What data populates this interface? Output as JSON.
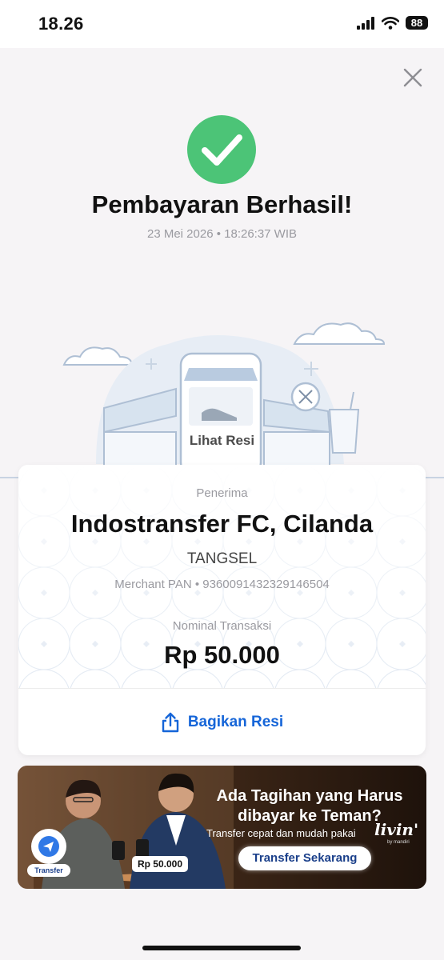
{
  "status_bar": {
    "time": "18.26",
    "battery": "88",
    "icons": [
      "signal-icon",
      "wifi-icon",
      "battery-icon"
    ]
  },
  "header": {
    "close_icon": "close-icon"
  },
  "result": {
    "icon": "check-circle-icon",
    "icon_color": "#4cc477",
    "title": "Pembayaran Berhasil!",
    "datetime": "23 Mei 2026 • 18:26:37 WIB"
  },
  "illustration": {
    "lihat_resi": "Lihat Resi"
  },
  "receipt": {
    "recipient_label": "Penerima",
    "recipient_name": "Indostransfer FC, Cilanda",
    "city": "TANGSEL",
    "merchant_pan": "Merchant PAN • 936009143232914650​4",
    "amount_label": "Nominal Transaksi",
    "amount": "Rp 50.000",
    "share_label": "Bagikan Resi",
    "share_icon": "share-icon",
    "accent": "#1565d8"
  },
  "banner": {
    "title_line1": "Ada Tagihan yang Harus",
    "title_line2": "dibayar ke Teman?",
    "subtitle": "Transfer cepat dan mudah pakai",
    "brand": "livin'",
    "brand_sub": "by mandiri",
    "button": "Transfer Sekarang",
    "transfer_label": "Transfer",
    "amount_chip": "Rp 50.000"
  }
}
